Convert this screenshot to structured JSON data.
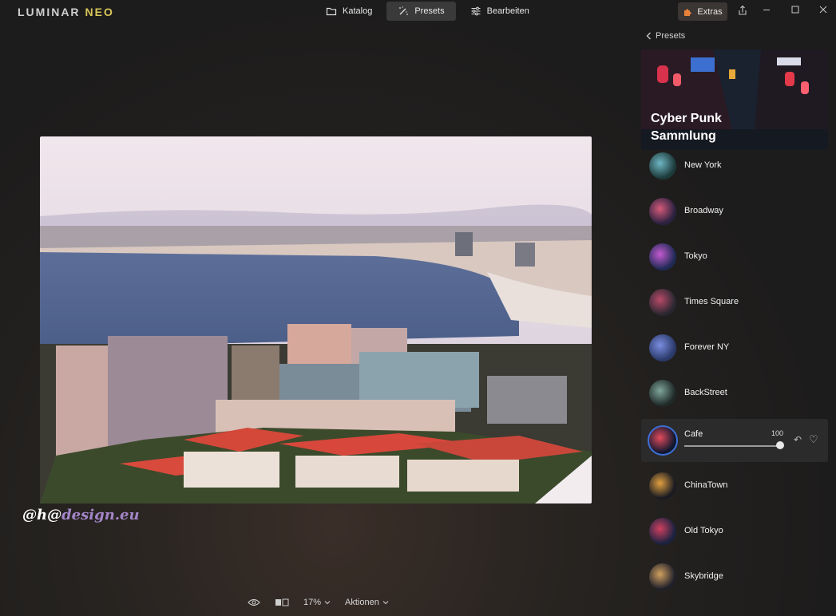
{
  "app": {
    "logo_part1": "LUMINAR",
    "logo_part2": "NEO"
  },
  "nav": {
    "tabs": [
      {
        "label": "Katalog",
        "icon": "folder-icon"
      },
      {
        "label": "Presets",
        "icon": "wand-icon",
        "active": true
      },
      {
        "label": "Bearbeiten",
        "icon": "sliders-icon"
      }
    ]
  },
  "header": {
    "extras_label": "Extras"
  },
  "watermark": {
    "part1": "@h@",
    "part2": "design.eu"
  },
  "bottombar": {
    "zoom": "17%",
    "actions_label": "Aktionen"
  },
  "panel": {
    "back_label": "Presets",
    "collection_title": "Cyber Punk Sammlung",
    "presets": [
      {
        "name": "New York"
      },
      {
        "name": "Broadway"
      },
      {
        "name": "Tokyo"
      },
      {
        "name": "Times Square"
      },
      {
        "name": "Forever NY"
      },
      {
        "name": "BackStreet"
      },
      {
        "name": "Cafe",
        "selected": true,
        "amount": "100"
      },
      {
        "name": "ChinaTown"
      },
      {
        "name": "Old Tokyo"
      },
      {
        "name": "Skybridge"
      }
    ]
  },
  "colors": {
    "accent_blue": "#3e6fd6",
    "extras_bg": "#3b3634",
    "logo_neo": "#d9c75a"
  }
}
